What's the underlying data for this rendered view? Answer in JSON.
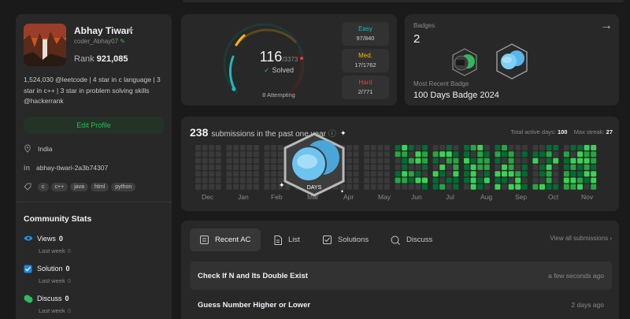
{
  "profile": {
    "name": "Abhay Tiwari",
    "username": "coder_Abhay07",
    "rank_label": "Rank",
    "rank_value": "921,085",
    "bio": "1,524,030 @leetcode | 4 star in c language | 3 star in c++ | 3 star in problem solving skills @hackerrank",
    "edit_button": "Edit Profile",
    "location": "India",
    "linkedin": "abhay-tiwari-2a3b74307",
    "skills": [
      "c",
      "c++",
      "java",
      "html",
      "python"
    ]
  },
  "community_stats": {
    "title": "Community Stats",
    "items": [
      {
        "label": "Views",
        "value": "0",
        "last_week_label": "Last week",
        "last_week_value": "0",
        "color": "#2196f3"
      },
      {
        "label": "Solution",
        "value": "0",
        "last_week_label": "Last week",
        "last_week_value": "0",
        "color": "#1e88e5"
      },
      {
        "label": "Discuss",
        "value": "0",
        "last_week_label": "Last week",
        "last_week_value": "0",
        "color": "#2cbb5d"
      }
    ]
  },
  "solved": {
    "count": "116",
    "total": "/3373",
    "label": "Solved",
    "attempting": "8",
    "attempting_label": "Attempting",
    "difficulties": [
      {
        "label": "Easy",
        "value": "97/840",
        "color": "#1cbaba"
      },
      {
        "label": "Med.",
        "value": "17/1762",
        "color": "#ffb700"
      },
      {
        "label": "Hard",
        "value": "2/771",
        "color": "#f63737"
      }
    ]
  },
  "badges": {
    "title": "Badges",
    "count": "2",
    "recent_label": "Most Recent Badge",
    "recent_name": "100 Days Badge 2024"
  },
  "calendar": {
    "count": "238",
    "label": "submissions in the past one year",
    "total_active_label": "Total active days:",
    "total_active_value": "100",
    "max_streak_label": "Max streak:",
    "max_streak_value": "27",
    "months": [
      "Dec",
      "Jan",
      "Feb",
      "Mar",
      "Apr",
      "May",
      "Jun",
      "Jul",
      "Aug",
      "Sep",
      "Oct",
      "Nov"
    ]
  },
  "floating_badge": {
    "text": "DAYS"
  },
  "submissions": {
    "tabs": [
      {
        "label": "Recent AC",
        "icon": "recent-ac-icon"
      },
      {
        "label": "List",
        "icon": "list-icon"
      },
      {
        "label": "Solutions",
        "icon": "solutions-icon"
      },
      {
        "label": "Discuss",
        "icon": "discuss-icon"
      }
    ],
    "view_all": "View all submissions",
    "rows": [
      {
        "title": "Check If N and Its Double Exist",
        "time": "a few seconds ago"
      },
      {
        "title": "Guess Number Higher or Lower",
        "time": "2 days ago"
      }
    ]
  }
}
